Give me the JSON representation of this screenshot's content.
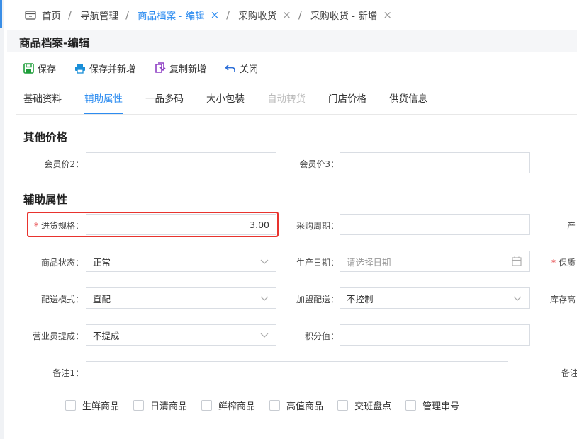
{
  "breadcrumbs": [
    {
      "label": "首页",
      "sep": "/"
    },
    {
      "label": "导航管理",
      "sep": "/"
    },
    {
      "label": "商品档案 - 编辑",
      "close": "×",
      "sep": "/"
    },
    {
      "label": "采购收货",
      "close": "×",
      "sep": "/"
    },
    {
      "label": "采购收货 - 新增",
      "close": "×"
    }
  ],
  "page_title": "商品档案-编辑",
  "toolbar": {
    "save": "保存",
    "save_and_new": "保存并新增",
    "copy_new": "复制新增",
    "close": "关闭"
  },
  "tabs": [
    "基础资料",
    "辅助属性",
    "一品多码",
    "大小包装",
    "自动转货",
    "门店价格",
    "供货信息"
  ],
  "sections": {
    "other_prices": "其他价格",
    "aux_attrs": "辅助属性"
  },
  "form": {
    "member_price2": {
      "label": "会员价2：",
      "value": ""
    },
    "member_price3": {
      "label": "会员价3：",
      "value": ""
    },
    "purchase_spec": {
      "label": "进货规格：",
      "value": "3.00",
      "required": "*"
    },
    "purchase_cycle": {
      "label": "采购周期：",
      "value": ""
    },
    "origin_partial": {
      "label": "产"
    },
    "product_status": {
      "label": "商品状态：",
      "value": "正常"
    },
    "production_date": {
      "label": "生产日期：",
      "placeholder": "请选择日期"
    },
    "shelf_partial": {
      "label": "保质",
      "required": "*"
    },
    "delivery_mode": {
      "label": "配送模式：",
      "value": "直配"
    },
    "franchise_delivery": {
      "label": "加盟配送：",
      "value": "不控制"
    },
    "stock_partial": {
      "label": "库存高"
    },
    "sales_commission": {
      "label": "营业员提成：",
      "value": "不提成"
    },
    "points": {
      "label": "积分值：",
      "value": ""
    },
    "remark1": {
      "label": "备注1：",
      "value": ""
    },
    "remark_partial": {
      "label": "备注"
    }
  },
  "checkboxes": [
    "生鲜商品",
    "日清商品",
    "鲜榨商品",
    "高值商品",
    "交班盘点",
    "管理串号"
  ],
  "colors": {
    "accent": "#2d8cf0",
    "highlight": "#e8332e",
    "save_icon": "#1e9e3a",
    "print_icon": "#1a8fd8",
    "copy_icon": "#8e3fc4"
  }
}
